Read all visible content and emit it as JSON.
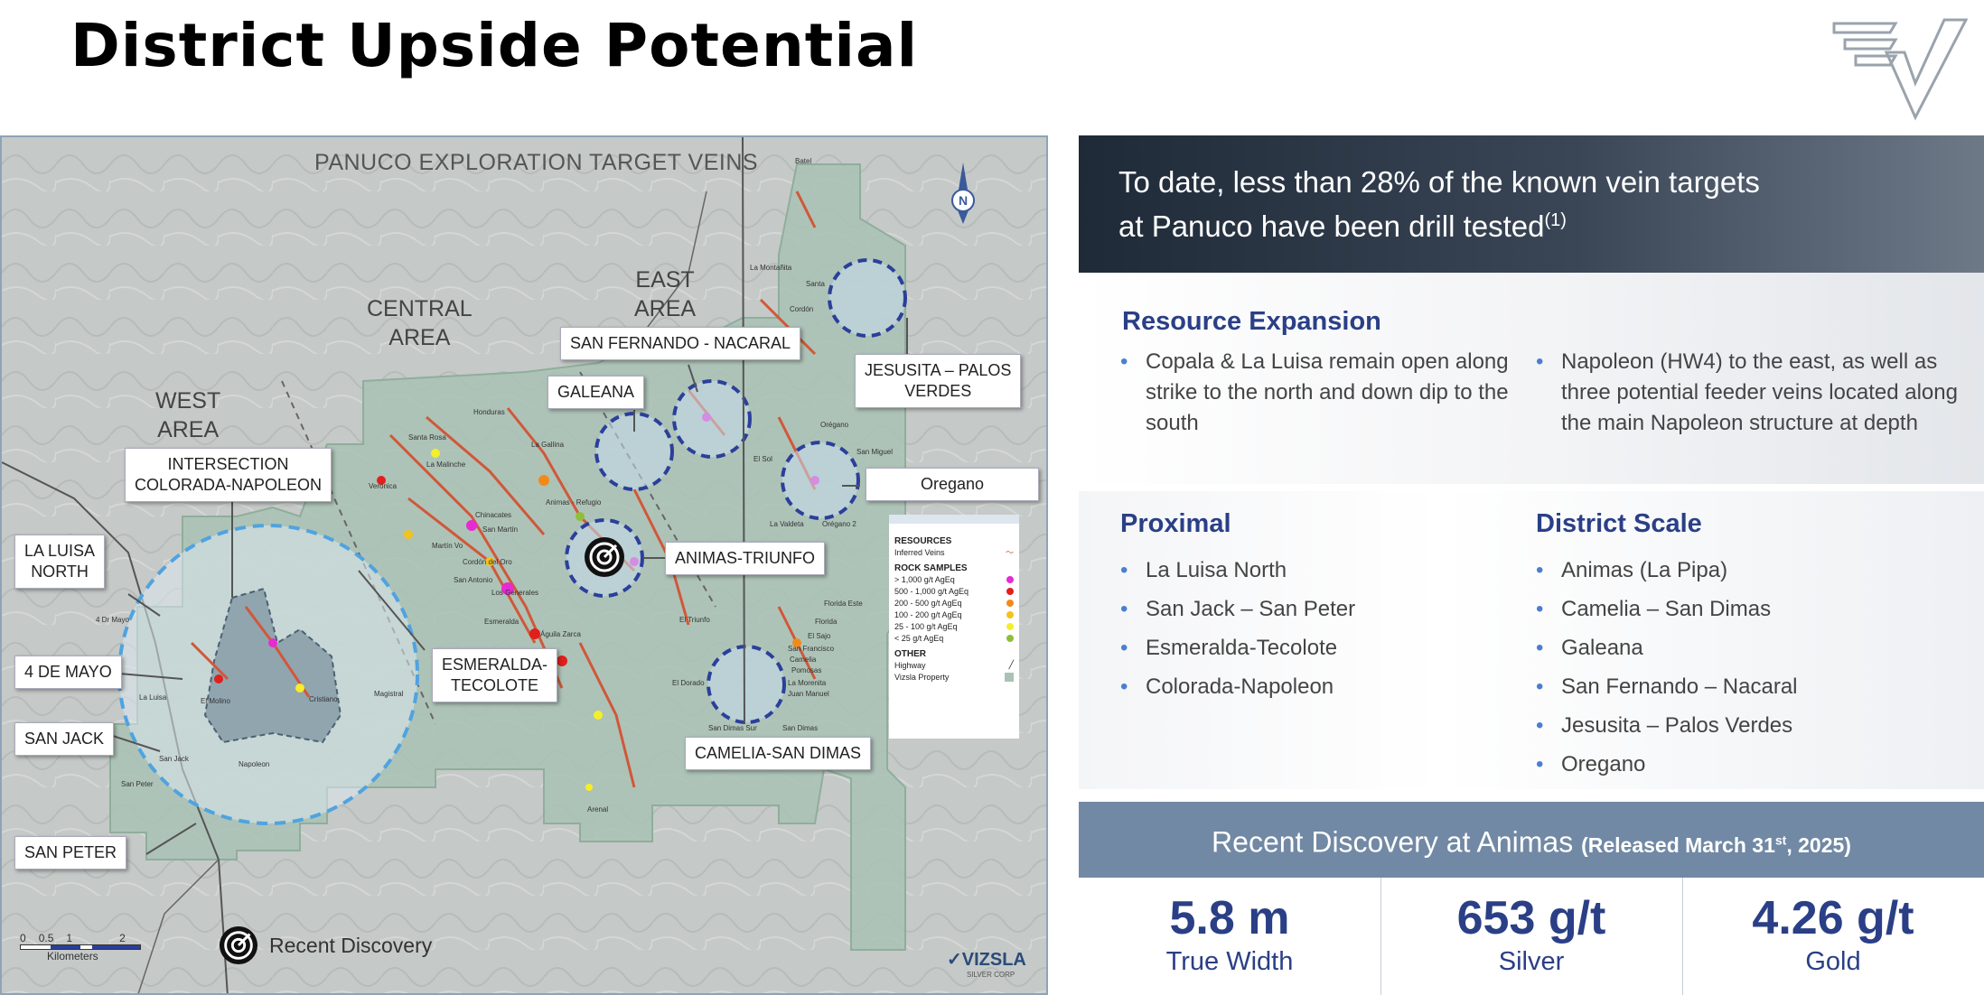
{
  "title": "District Upside Potential",
  "map": {
    "title": "PANUCO EXPLORATION TARGET VEINS",
    "areas": {
      "west": [
        "WEST",
        "AREA"
      ],
      "central": [
        "CENTRAL",
        "AREA"
      ],
      "east": [
        "EAST",
        "AREA"
      ]
    },
    "labels": {
      "intersection": [
        "INTERSECTION",
        "COLORADA-NAPOLEON"
      ],
      "la_luisa": [
        "LA LUISA",
        "NORTH"
      ],
      "cuatro_de_mayo": "4 DE MAYO",
      "san_jack": "SAN JACK",
      "san_peter": "SAN PETER",
      "esmeralda": [
        "ESMERALDA-",
        "TECOLOTE"
      ],
      "galeana": "GALEANA",
      "san_fernando": "SAN FERNANDO - NACARAL",
      "jesusita": [
        "JESUSITA – PALOS",
        "VERDES"
      ],
      "oregano": "Oregano",
      "animas": "ANIMAS-TRIUNFO",
      "camelia": "CAMELIA-SAN DIMAS"
    },
    "towns": {
      "batel": "Batel",
      "la_montanita": "La Montañita",
      "santa": "Santa",
      "cordon": "Cordón",
      "honduras": "Honduras",
      "santa_rosa": "Santa Rosa",
      "la_gallina": "La Gallina",
      "la_malinche": "La Malinche",
      "veronica": "Verónica",
      "chinacates": "Chinacates",
      "san_martin": "San Martín",
      "martin_vo": "Martín Vo",
      "cordon_del_oro": "Cordón del Oro",
      "animas_refugio": "Animas - Refugio",
      "san_antonio": "San Antonio",
      "los_generales": "Los Generales",
      "esmeralda": "Esmeralda",
      "aguila_zarca": "Águila Zarca",
      "cuatro_de_mayo": "4 Dr Mayo",
      "la_luisa": "La Luisa",
      "el_molino": "El Molino",
      "san_jack": "San Jack",
      "san_peter": "San Peter",
      "napoleon": "Napoleon",
      "cristiano": "Cristiano",
      "magistral": "Magistral",
      "el_triunfo": "El Triunfo",
      "el_dorado": "El Dorado",
      "la_valdeta": "La Valdeta",
      "oregano2": "Orégano 2",
      "san_miguel": "San Miguel",
      "florida_este": "Florida Este",
      "florida": "Florida",
      "el_sajo": "El Sajo",
      "san_francisco": "San Francisco",
      "camelia": "Camelia",
      "la_morenita": "La Morenita",
      "juan_manuel": "Juan Manuel",
      "san_dimas": "San Dimas",
      "san_dimas_sur": "San Dimas Sur",
      "arenal": "Arenal",
      "oregano": "Orégano",
      "el_sol": "El Sol",
      "pomosas": "Pomosas"
    },
    "legend": {
      "resources": "RESOURCES",
      "inferred_veins": "Inferred Veins",
      "rock_samples": "ROCK SAMPLES",
      "samples": [
        {
          "label": "> 1,000  g/t  AgEq",
          "color": "#e62ad4"
        },
        {
          "label": "500 - 1,000 g/t  AgEq",
          "color": "#e0201c"
        },
        {
          "label": "200 - 500 g/t  AgEq",
          "color": "#f28a1a"
        },
        {
          "label": "100 - 200  g/t  AgEq",
          "color": "#f4c21a"
        },
        {
          "label": "25  -  100  g/t  AgEq",
          "color": "#f5ee2a"
        },
        {
          "label": "<  25    g/t   AgEq",
          "color": "#8fbf3a"
        }
      ],
      "other": "OTHER",
      "highway": "Highway",
      "vizsla_property": "Vizsla Property"
    },
    "recent_discovery": "Recent Discovery",
    "scale_ticks": [
      "0",
      "0.5",
      "1",
      "2"
    ],
    "scale_unit": "Kilometers",
    "brand": "VIZSLA",
    "brand_sub": "SILVER CORP"
  },
  "banner": {
    "line1": "To date, less than 28% of the known vein targets",
    "line2": "at Panuco have been drill tested",
    "footnote": "(1)"
  },
  "resource_expansion": {
    "title": "Resource Expansion",
    "col1": [
      "Copala & La Luisa remain open along strike to the north and down dip to the south"
    ],
    "col2": [
      "Napoleon (HW4) to the east, as well as three potential feeder veins located along the main Napoleon structure at depth"
    ]
  },
  "proximal": {
    "title": "Proximal",
    "items": [
      "La Luisa North",
      "San Jack – San Peter",
      "Esmeralda-Tecolote",
      "Colorada-Napoleon"
    ]
  },
  "district_scale": {
    "title": "District Scale",
    "items": [
      "Animas (La Pipa)",
      "Camelia – San Dimas",
      "Galeana",
      "San Fernando – Nacaral",
      "Jesusita – Palos Verdes",
      "Oregano"
    ]
  },
  "discovery": {
    "title": "Recent Discovery at Animas",
    "released_prefix": "(Released March 31",
    "released_sup": "st",
    "released_suffix": ", 2025)",
    "stats": [
      {
        "value": "5.8 m",
        "label": "True Width"
      },
      {
        "value": "653 g/t",
        "label": "Silver"
      },
      {
        "value": "4.26 g/t",
        "label": "Gold"
      }
    ]
  }
}
